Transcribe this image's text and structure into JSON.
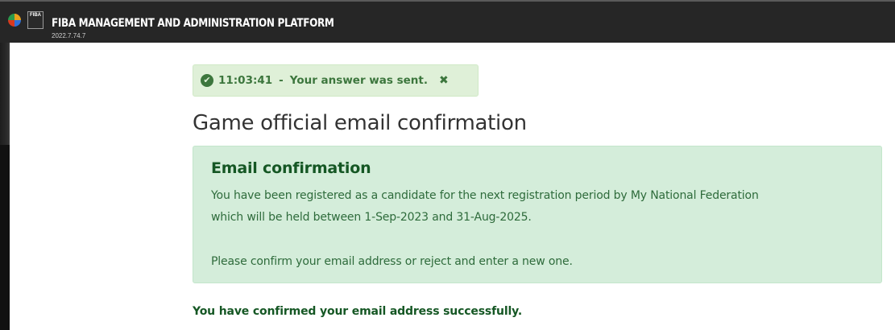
{
  "header": {
    "app_title": "FIBA MANAGEMENT AND ADMINISTRATION PLATFORM",
    "version": "2022.7.74.7",
    "logo_text": "FIBA"
  },
  "toast": {
    "time": "11:03:41",
    "separator": "-",
    "message": "Your answer was sent.",
    "close_glyph": "✖",
    "check_glyph": "✔"
  },
  "page": {
    "title": "Game official email confirmation"
  },
  "panel": {
    "heading": "Email confirmation",
    "line1": "You have been registered as a candidate for the next registration period by My National Federation",
    "line2": "which will be held between 1-Sep-2023 and 31-Aug-2025.",
    "line3": "Please confirm your email address or reject and enter a new one."
  },
  "status": {
    "success_message": "You have confirmed your email address successfully."
  },
  "colors": {
    "header_bg": "#262626",
    "toast_bg": "#dff0d8",
    "toast_text": "#3c763d",
    "panel_bg": "#d4edda",
    "panel_heading": "#155724"
  }
}
